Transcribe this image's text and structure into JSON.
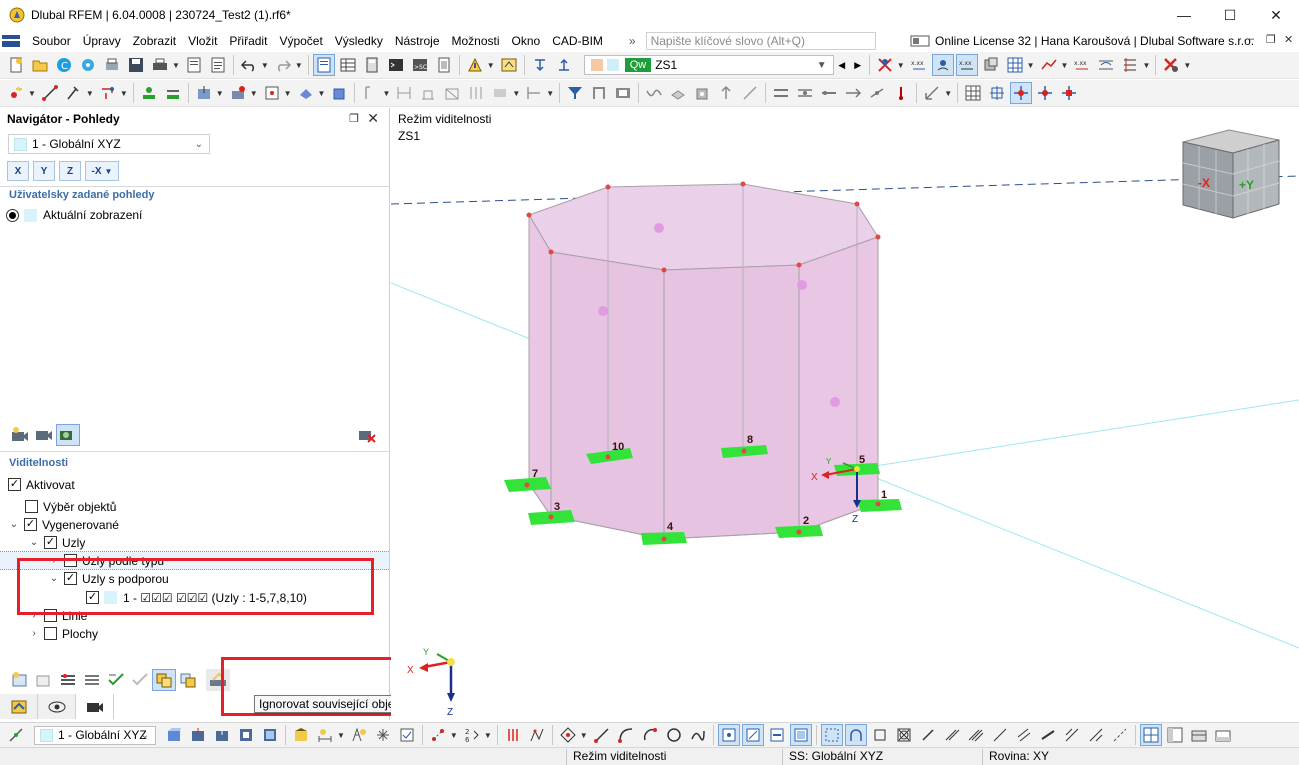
{
  "window": {
    "title": "Dlubal RFEM | 6.04.0008 | 230724_Test2 (1).rf6*",
    "minimize": "—",
    "maximize": "☐",
    "close": "✕"
  },
  "menu": {
    "items": [
      "Soubor",
      "Úpravy",
      "Zobrazit",
      "Vložit",
      "Přiřadit",
      "Výpočet",
      "Výsledky",
      "Nástroje",
      "Možnosti",
      "Okno",
      "CAD-BIM"
    ],
    "overflow": "»",
    "search_placeholder": "Napište klíčové slovo (Alt+Q)",
    "license": "Online License 32 | Hana Karoušová | Dlubal Software s.r.o."
  },
  "toolbar": {
    "load_case_badge": "Qw",
    "load_case": "ZS1"
  },
  "navigator": {
    "title": "Navigátor - Pohledy",
    "view_combo": "1 - Globální XYZ",
    "axis_buttons": [
      "X",
      "Y",
      "Z",
      "-X"
    ],
    "user_views_title": "Uživatelsky zadané pohledy",
    "current_view": "Aktuální zobrazení",
    "visibility_title": "Viditelnosti",
    "tree": {
      "activate": "Aktivovat",
      "object_selection": "Výběr objektů",
      "generated": "Vygenerované",
      "nodes": "Uzly",
      "nodes_by_type": "Uzly podle typu",
      "nodes_with_support": "Uzly s podporou",
      "support_item": "1 - ☑☑☑ ☑☑☑ (Uzly : 1-5,7,8,10)",
      "lines": "Linie",
      "surfaces": "Plochy"
    },
    "tooltip": "Ignorovat související objekty"
  },
  "viewport": {
    "mode_label": "Režim viditelnosti",
    "load_case_label": "ZS1",
    "node_labels": [
      "10",
      "8",
      "7",
      "5",
      "1",
      "3",
      "4",
      "2"
    ],
    "axis_labels": {
      "x": "X",
      "y": "Y",
      "z": "Z"
    },
    "cube_labels": {
      "neg_x": "-X",
      "pos_y": "+Y"
    }
  },
  "bottom_toolbar": {
    "view_combo": "1 - Globální XYZ"
  },
  "status": {
    "mode": "Režim viditelnosti",
    "cs": "SS: Globální XYZ",
    "plane": "Rovina: XY"
  },
  "colors": {
    "surface_fill": "#eac9e6",
    "support": "#33e33a",
    "highlight": "#e5202b",
    "accent": "#3d6ea8"
  }
}
